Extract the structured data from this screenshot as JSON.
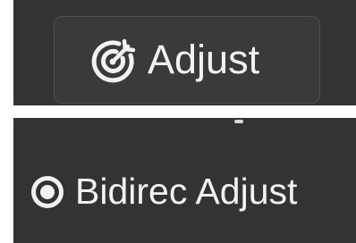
{
  "adjust_button": {
    "label": "Adjust",
    "icon": "target-adjust-icon"
  },
  "bidirec_option": {
    "label": "Bidirec Adjust",
    "selected": true,
    "icon": "radio-selected-icon"
  },
  "colors": {
    "panel_background": "#333333",
    "button_background": "#3a3a3a",
    "button_border": "#4f4f4f",
    "text": "#f2f2f2"
  }
}
